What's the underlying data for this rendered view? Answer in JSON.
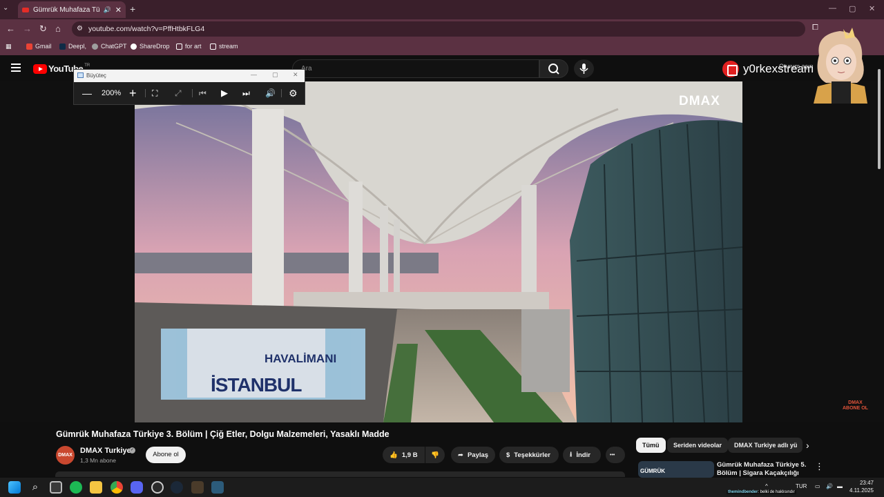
{
  "browser": {
    "tab_title": "Gümrük Muhafaza Türkiye",
    "new_tab": "+",
    "tab_list": "⌄",
    "url": "youtube.com/watch?v=PffHtbkFLG4",
    "bookmarks": [
      "Gmail",
      "Deepl,",
      "ChatGPT",
      "ShareDrop",
      "for art",
      "stream"
    ],
    "bookmark_colors": [
      "#ea4335",
      "#0f2b46",
      "#9e9e9e",
      "#ffffff",
      "#ffffff",
      "#ffffff"
    ]
  },
  "youtube": {
    "logo_word": "YouTube",
    "country": "TR",
    "search_placeholder": "Ara",
    "login_label": "Oturum açın"
  },
  "overlay": {
    "streamer_name": "y0rkexstream"
  },
  "magnifier": {
    "title": "Büyüteç",
    "zoom": "200%",
    "minus": "—",
    "plus": "+"
  },
  "video": {
    "watermark": "DMAX",
    "watermark_sub": "DMAX",
    "watermark_sub2": "ABONE OL",
    "sign_line1": "HAVALİMANI",
    "sign_line2": "İSTANBUL",
    "title": "Gümrük Muhafaza Türkiye 3. Bölüm | Çiğ Etler, Dolgu Malzemeleri, Yasaklı Madde",
    "channel": "DMAX Turkiye",
    "channel_avatar": "DMAX",
    "subscribers": "1,3 Mn abone",
    "subscribe": "Abone ol",
    "likes": "1,9 B",
    "share": "Paylaş",
    "thanks": "Teşekkürler",
    "download": "İndir",
    "more": "•••"
  },
  "sidebar": {
    "chips": [
      "Tümü",
      "Seriden videolar",
      "DMAX Turkiye adlı yü"
    ],
    "rec_thumb_text": "GÜMRÜK",
    "rec_title": "Gümrük Muhafaza Türkiye 5. Bölüm | Sigara Kaçakçılığı"
  },
  "taskbar": {
    "lang": "TUR",
    "time": "23:47",
    "date": "4.11.2025",
    "chat_user": "themindbender",
    "chat_text": ": belki de haklısındır"
  }
}
